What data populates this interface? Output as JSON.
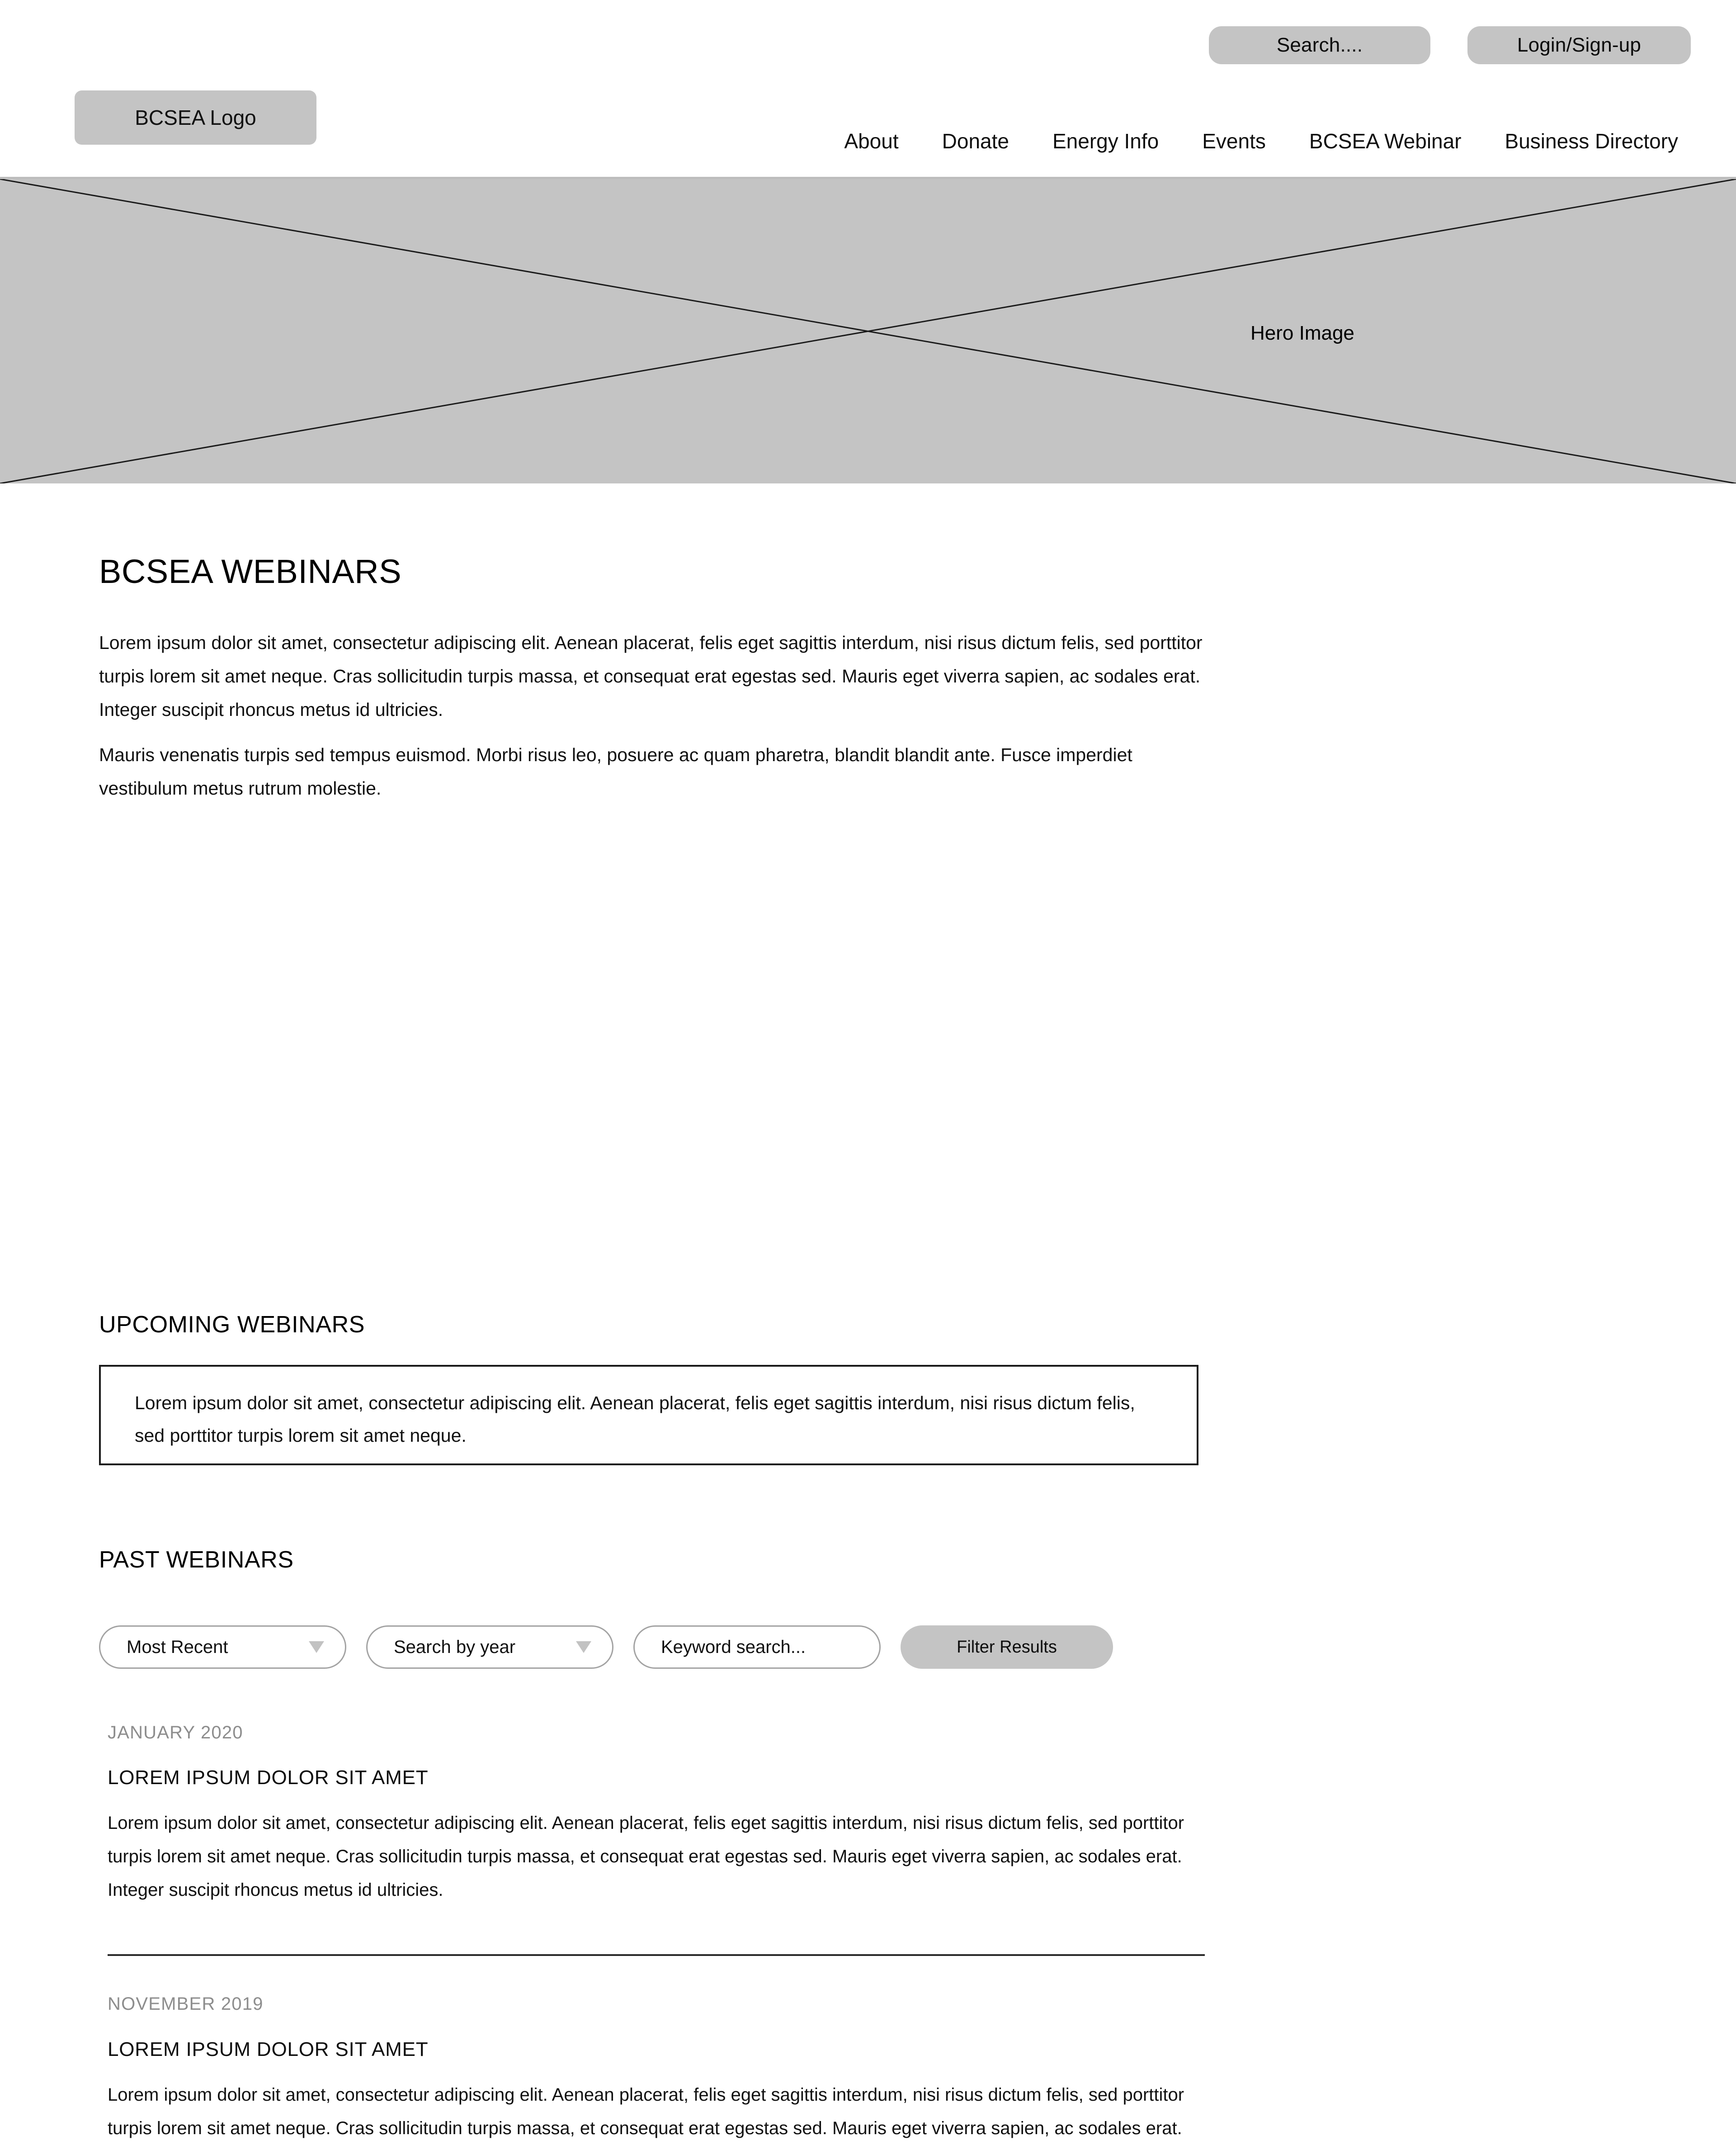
{
  "header": {
    "search_button_label": "Search....",
    "login_button_label": "Login/Sign-up",
    "logo_label": "BCSEA Logo",
    "nav_items": [
      {
        "label": "About"
      },
      {
        "label": "Donate"
      },
      {
        "label": "Energy Info"
      },
      {
        "label": "Events"
      },
      {
        "label": "BCSEA Webinar"
      },
      {
        "label": "Business Directory"
      }
    ]
  },
  "hero": {
    "label": "Hero Image",
    "placeholder_fill": "#c4c4c4"
  },
  "main": {
    "page_title": "BCSEA WEBINARS",
    "intro_paragraph_1": "Lorem ipsum dolor sit amet, consectetur adipiscing elit. Aenean placerat, felis eget sagittis interdum, nisi risus dictum felis, sed porttitor turpis lorem sit amet neque. Cras sollicitudin turpis massa, et consequat erat egestas sed. Mauris eget viverra sapien, ac sodales erat. Integer suscipit rhoncus metus id ultricies.",
    "intro_paragraph_2": "Mauris venenatis turpis sed tempus euismod. Morbi risus leo, posuere ac quam pharetra, blandit blandit ante. Fusce imperdiet vestibulum metus rutrum molestie.",
    "upcoming_heading": "UPCOMING WEBINARS",
    "upcoming_box_text": "Lorem ipsum dolor sit amet, consectetur adipiscing elit. Aenean placerat, felis eget sagittis interdum, nisi risus dictum felis, sed porttitor turpis lorem sit amet neque.",
    "past_heading": "PAST WEBINARS"
  },
  "filters": {
    "sort_value": "Most Recent",
    "year_value": "Search by year",
    "keyword_placeholder": "Keyword search...",
    "filter_button_label": "Filter Results"
  },
  "webinars": [
    {
      "date": "JANUARY 2020",
      "title": "LOREM IPSUM DOLOR SIT AMET",
      "body": "Lorem ipsum dolor sit amet, consectetur adipiscing elit. Aenean placerat, felis eget sagittis interdum, nisi risus dictum felis, sed porttitor turpis lorem sit amet neque. Cras sollicitudin turpis massa, et consequat erat egestas sed. Mauris eget viverra sapien, ac sodales erat. Integer suscipit rhoncus metus id ultricies."
    },
    {
      "date": "NOVEMBER 2019",
      "title": "LOREM IPSUM DOLOR SIT AMET",
      "body": "Lorem ipsum dolor sit amet, consectetur adipiscing elit. Aenean placerat, felis eget sagittis interdum, nisi risus dictum felis, sed porttitor turpis lorem sit amet neque. Cras sollicitudin turpis massa, et consequat erat egestas sed. Mauris eget viverra sapien, ac sodales erat."
    }
  ],
  "colors": {
    "placeholder_gray": "#c4c4c4",
    "border_gray": "#a3a3a3",
    "muted_text": "#8d8d8d"
  }
}
